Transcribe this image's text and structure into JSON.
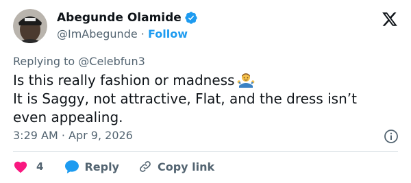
{
  "author": {
    "display_name": "Abegunde Olamide",
    "handle": "@ImAbegunde",
    "separator": " · ",
    "follow_label": "Follow",
    "verified": true
  },
  "reply_to": {
    "text": "Replying to @Celebfun3"
  },
  "tweet": {
    "line1": "Is this really fashion or madness",
    "line2": "It is Saggy, not attractive, Flat, and the dress isn’t",
    "line3": "even appealing.",
    "emoji": "man-shrugging-emoji",
    "timestamp": "3:29 AM · Apr 9, 2026"
  },
  "actions": {
    "like_count": "4",
    "reply_label": "Reply",
    "copy_link_label": "Copy link"
  },
  "colors": {
    "accent": "#1d9bf0",
    "like": "#f91880",
    "muted": "#536471",
    "text": "#0f1419",
    "divider": "#cfd9de"
  },
  "icons": {
    "brand": "x-logo-icon",
    "verified": "verified-badge-icon",
    "info": "info-icon",
    "like": "heart-icon",
    "reply": "speech-bubble-icon",
    "copy": "link-icon"
  }
}
